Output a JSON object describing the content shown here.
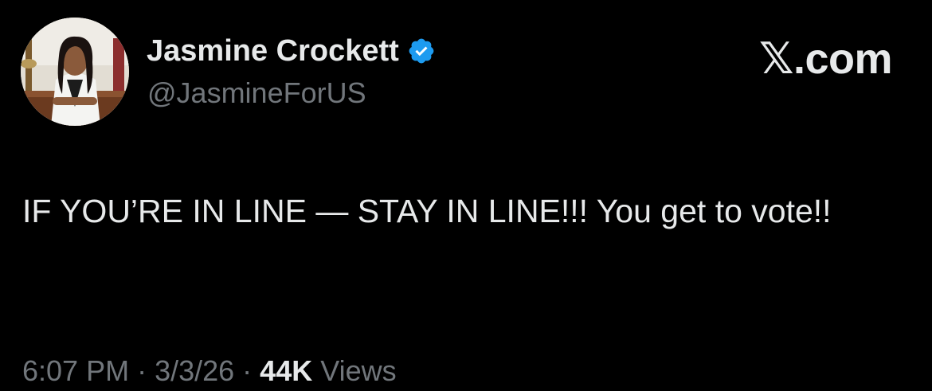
{
  "author": {
    "name": "Jasmine Crockett",
    "handle": "@JasmineForUS",
    "verified": true,
    "verified_badge_color": "#1d9bf0",
    "avatar_icon": "profile-photo"
  },
  "brand": {
    "label": "𝕏.com"
  },
  "tweet": {
    "text": "IF YOU’RE IN LINE — STAY IN LINE!!! You get to vote!!"
  },
  "meta": {
    "time": "6:07 PM",
    "separator_1": " · ",
    "date": "3/3/26",
    "separator_2": " · ",
    "views_count": "44K",
    "views_label": " Views"
  },
  "colors": {
    "background": "#000000",
    "primary_text": "#e7e9ea",
    "secondary_text": "#71767b"
  }
}
